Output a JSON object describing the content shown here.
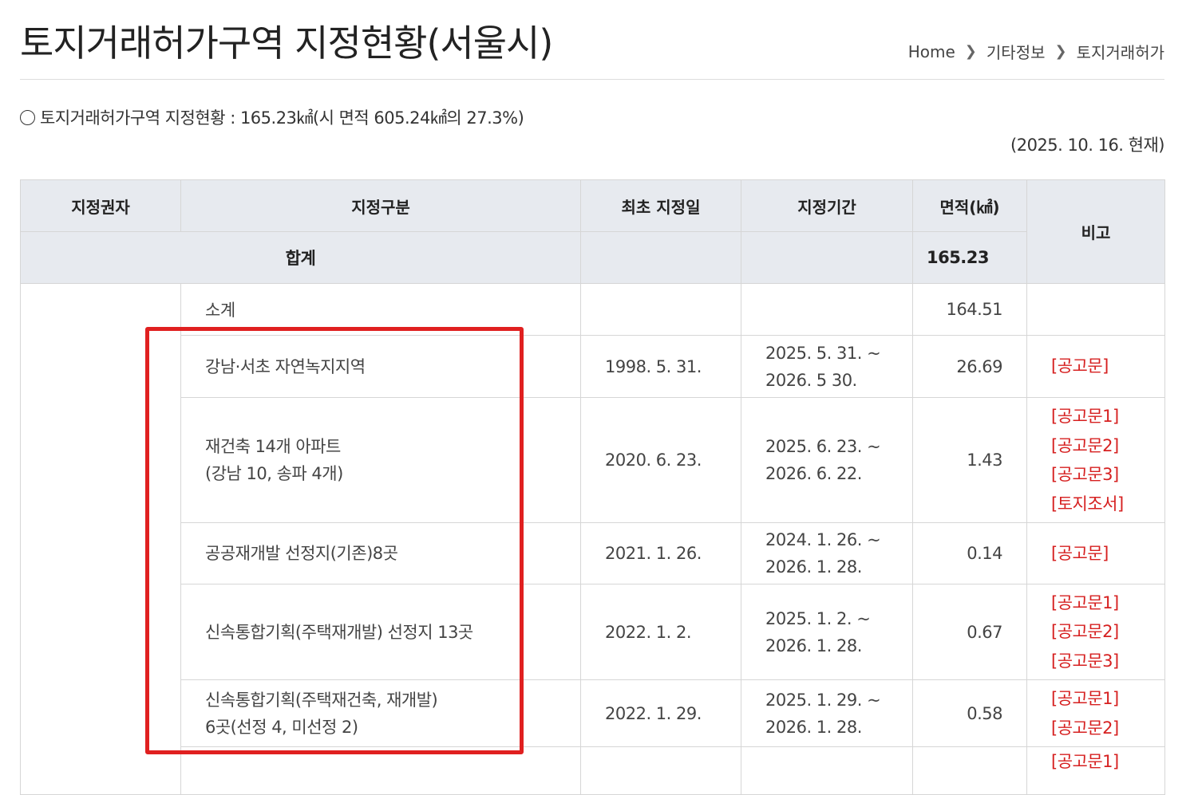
{
  "header": {
    "title": "토지거래허가구역 지정현황(서울시)",
    "breadcrumb": [
      "Home",
      "기타정보",
      "토지거래허가"
    ]
  },
  "summary": {
    "text": "토지거래허가구역 지정현황 : 165.23㎢(시 면적 605.24㎢의 27.3%)",
    "as_of": "(2025. 10. 16. 현재)"
  },
  "table": {
    "columns": [
      "지정권자",
      "지정구분",
      "최초 지정일",
      "지정기간",
      "면적(㎢)",
      "비고"
    ],
    "total_label": "합계",
    "total_area": "165.23",
    "subtotal_label": "소계",
    "subtotal_area": "164.51",
    "rows": [
      {
        "category": [
          "강남·서초 자연녹지지역"
        ],
        "first_date": "1998. 5. 31.",
        "period": [
          "2025. 5. 31. ~",
          "2026. 5 30."
        ],
        "area": "26.69",
        "notes": [
          "[공고문]"
        ]
      },
      {
        "category": [
          "재건축 14개 아파트",
          "(강남 10, 송파 4개)"
        ],
        "first_date": "2020. 6. 23.",
        "period": [
          "2025. 6. 23. ~",
          "2026. 6. 22."
        ],
        "area": "1.43",
        "notes": [
          "[공고문1]",
          "[공고문2]",
          "[공고문3]",
          "[토지조서]"
        ]
      },
      {
        "category": [
          "공공재개발 선정지(기존)8곳"
        ],
        "first_date": "2021. 1. 26.",
        "period": [
          "2024. 1. 26. ~",
          "2026. 1. 28."
        ],
        "area": "0.14",
        "notes": [
          "[공고문]"
        ]
      },
      {
        "category": [
          "신속통합기획(주택재개발) 선정지 13곳"
        ],
        "first_date": "2022. 1. 2.",
        "period": [
          "2025. 1. 2. ~",
          "2026. 1. 28."
        ],
        "area": "0.67",
        "notes": [
          "[공고문1]",
          "[공고문2]",
          "[공고문3]"
        ]
      },
      {
        "category": [
          "신속통합기획(주택재건축, 재개발)",
          "6곳(선정 4, 미선정 2)"
        ],
        "first_date": "2022. 1. 29.",
        "period": [
          "2025. 1. 29. ~",
          "2026. 1. 28."
        ],
        "area": "0.58",
        "notes": [
          "[공고문1]",
          "[공고문2]"
        ]
      },
      {
        "category": [
          ""
        ],
        "first_date": "",
        "period": [
          ""
        ],
        "area": "",
        "notes": [
          "[공고문1]"
        ]
      }
    ]
  },
  "colors": {
    "header_bg": "#e7eaef",
    "link_red": "#d62020",
    "highlight_red": "#e02020"
  }
}
